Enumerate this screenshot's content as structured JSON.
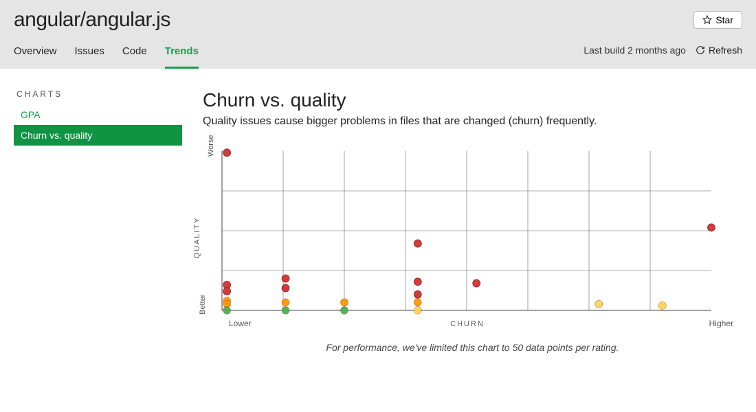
{
  "header": {
    "title": "angular/angular.js",
    "star_label": "Star",
    "last_build": "Last build 2 months ago",
    "refresh_label": "Refresh"
  },
  "tabs": [
    {
      "label": "Overview",
      "active": false
    },
    {
      "label": "Issues",
      "active": false
    },
    {
      "label": "Code",
      "active": false
    },
    {
      "label": "Trends",
      "active": true
    }
  ],
  "sidebar": {
    "header": "CHARTS",
    "items": [
      {
        "label": "GPA",
        "active": false
      },
      {
        "label": "Churn vs. quality",
        "active": true
      }
    ]
  },
  "main": {
    "title": "Churn vs. quality",
    "description": "Quality issues cause bigger problems in files that are changed (churn) frequently.",
    "caption": "For performance, we've limited this chart to 50 data points per rating."
  },
  "chart_data": {
    "type": "scatter",
    "title": "Churn vs. quality",
    "xlabel": "CHURN",
    "ylabel": "QUALITY",
    "x_ticks": [
      "Lower",
      "Higher"
    ],
    "y_ticks": [
      "Better",
      "Worse"
    ],
    "xlim": [
      0,
      100
    ],
    "ylim": [
      0,
      100
    ],
    "colors": {
      "green": "#4caf50",
      "yellow": "#ffd54f",
      "orange": "#ff9800",
      "red": "#d32f2f"
    },
    "points": [
      {
        "x": 1,
        "y": 99,
        "rating": "red"
      },
      {
        "x": 1,
        "y": 16,
        "rating": "red"
      },
      {
        "x": 1,
        "y": 12,
        "rating": "red"
      },
      {
        "x": 1,
        "y": 6,
        "rating": "orange"
      },
      {
        "x": 1,
        "y": 4,
        "rating": "orange"
      },
      {
        "x": 1,
        "y": 0,
        "rating": "green"
      },
      {
        "x": 13,
        "y": 20,
        "rating": "red"
      },
      {
        "x": 13,
        "y": 14,
        "rating": "red"
      },
      {
        "x": 13,
        "y": 5,
        "rating": "orange"
      },
      {
        "x": 13,
        "y": 0,
        "rating": "green"
      },
      {
        "x": 25,
        "y": 5,
        "rating": "orange"
      },
      {
        "x": 25,
        "y": 0,
        "rating": "green"
      },
      {
        "x": 40,
        "y": 42,
        "rating": "red"
      },
      {
        "x": 40,
        "y": 18,
        "rating": "red"
      },
      {
        "x": 40,
        "y": 10,
        "rating": "red"
      },
      {
        "x": 40,
        "y": 5,
        "rating": "orange"
      },
      {
        "x": 40,
        "y": 0,
        "rating": "yellow"
      },
      {
        "x": 52,
        "y": 17,
        "rating": "red"
      },
      {
        "x": 77,
        "y": 4,
        "rating": "yellow"
      },
      {
        "x": 90,
        "y": 3,
        "rating": "yellow"
      },
      {
        "x": 100,
        "y": 52,
        "rating": "red"
      }
    ]
  }
}
